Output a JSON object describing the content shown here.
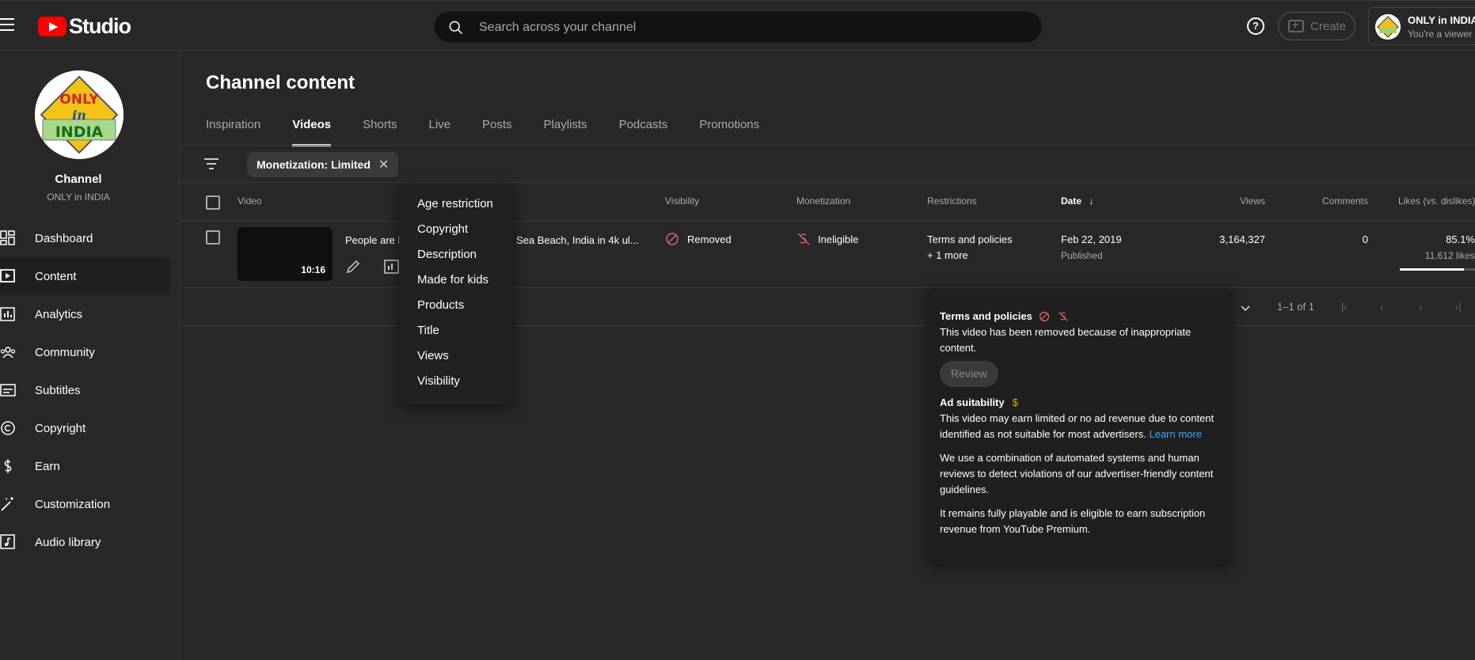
{
  "app": {
    "name": "Studio"
  },
  "search": {
    "placeholder": "Search across your channel"
  },
  "header": {
    "help_label": "?",
    "create_label": "Create",
    "account_name": "ONLY in INDIA",
    "account_role": "You're a viewer"
  },
  "channel": {
    "title": "Channel",
    "name": "ONLY in INDIA",
    "logo_text": [
      "ONLY",
      "in",
      "INDIA"
    ]
  },
  "sidebar": {
    "items": [
      {
        "label": "Dashboard",
        "icon": "dashboard-icon"
      },
      {
        "label": "Content",
        "icon": "content-icon",
        "active": true
      },
      {
        "label": "Analytics",
        "icon": "analytics-icon"
      },
      {
        "label": "Community",
        "icon": "community-icon"
      },
      {
        "label": "Subtitles",
        "icon": "subtitles-icon"
      },
      {
        "label": "Copyright",
        "icon": "copyright-icon"
      },
      {
        "label": "Earn",
        "icon": "dollar-icon"
      },
      {
        "label": "Customization",
        "icon": "magic-wand-icon"
      },
      {
        "label": "Audio library",
        "icon": "audio-library-icon"
      }
    ]
  },
  "main": {
    "title": "Channel content",
    "tabs": [
      "Inspiration",
      "Videos",
      "Shorts",
      "Live",
      "Posts",
      "Playlists",
      "Podcasts",
      "Promotions"
    ],
    "active_tab": "Videos",
    "filter_chip": "Monetization: Limited"
  },
  "table": {
    "headers": {
      "video": "Video",
      "visibility": "Visibility",
      "monetization": "Monetization",
      "restrictions": "Restrictions",
      "date": "Date",
      "views": "Views",
      "comments": "Comments",
      "likes": "Likes (vs. dislikes)"
    },
    "row": {
      "title_left": "People are l",
      "title_right": "Sea Beach, India in 4k ul...",
      "duration": "10:16",
      "visibility": "Removed",
      "monetization": "Ineligible",
      "restriction": "Terms and policies",
      "restriction_more": "+ 1 more",
      "date": "Feb 22, 2019",
      "date_status": "Published",
      "views": "3,164,327",
      "comments": "0",
      "likes_pct": "85.1%",
      "likes_count": "11,612 likes",
      "likes_ratio": 0.851
    },
    "pagination": {
      "range": "1–1 of 1"
    }
  },
  "sort_menu": {
    "items": [
      "Age restriction",
      "Copyright",
      "Description",
      "Made for kids",
      "Products",
      "Title",
      "Views",
      "Visibility"
    ]
  },
  "restriction_card": {
    "terms_title": "Terms and policies",
    "terms_text": "This video has been removed because of inappropriate content.",
    "review_label": "Review",
    "ad_title": "Ad suitability",
    "ad_text": "This video may earn limited or no ad revenue due to content identified as not suitable for most advertisers.",
    "learn_more": "Learn more",
    "para2": "We use a combination of automated systems and human reviews to detect violations of our advertiser-friendly content guidelines.",
    "para3": "It remains fully playable and is eligible to earn subscription revenue from YouTube Premium."
  },
  "colors": {
    "accent_red": "#ff0000",
    "link": "#3ea6ff",
    "removed": "#e06060",
    "ad_yellow": "#e0b000"
  }
}
